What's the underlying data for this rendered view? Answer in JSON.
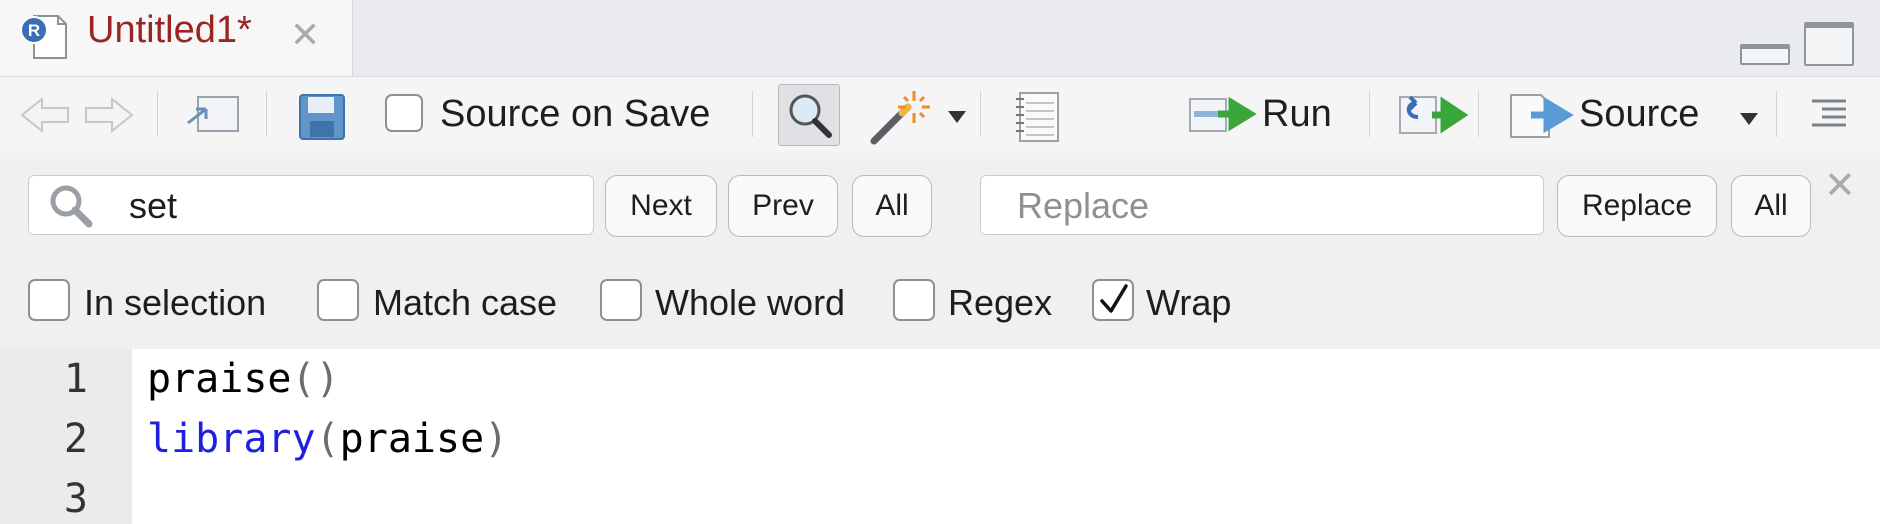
{
  "tab": {
    "title": "Untitled1*",
    "close_glyph": "✕",
    "icon": "r-script-file-icon"
  },
  "window_controls": {
    "minimize_icon": "minimize-pane-icon",
    "maximize_icon": "maximize-pane-icon"
  },
  "toolbar": {
    "source_on_save_label": "Source on Save",
    "source_on_save_checked": false,
    "run_label": "Run",
    "source_label": "Source"
  },
  "find": {
    "search_value": "set",
    "replace_placeholder": "Replace",
    "next_label": "Next",
    "prev_label": "Prev",
    "all_label": "All",
    "replace_button_label": "Replace",
    "replace_all_label": "All",
    "close_glyph": "✕",
    "options": [
      {
        "label": "In selection",
        "checked": false
      },
      {
        "label": "Match case",
        "checked": false
      },
      {
        "label": "Whole word",
        "checked": false
      },
      {
        "label": "Regex",
        "checked": false
      },
      {
        "label": "Wrap",
        "checked": true
      }
    ]
  },
  "editor": {
    "lines": [
      {
        "number": "1",
        "fn": "praise",
        "open": "(",
        "arg": "",
        "close": ")"
      },
      {
        "number": "2",
        "fn": "library",
        "open": "(",
        "arg": "praise",
        "close": ")"
      },
      {
        "number": "3",
        "fn": "",
        "open": "",
        "arg": "",
        "close": ""
      }
    ]
  },
  "colors": {
    "tab_title": "#9b2424",
    "keyword": "#1f1fe0",
    "run_arrow": "#3aa63a",
    "source_arrow": "#5b9bd5"
  }
}
